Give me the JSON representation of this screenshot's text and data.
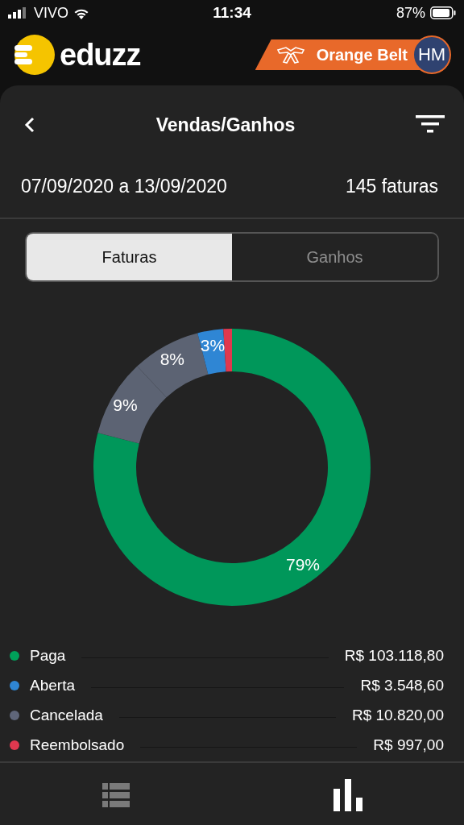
{
  "status_bar": {
    "carrier": "VIVO",
    "time": "11:34",
    "battery": "87%"
  },
  "header": {
    "logo": "eduzz",
    "badge": "Orange Belt",
    "avatar": "HM"
  },
  "title_bar": {
    "title": "Vendas/Ganhos"
  },
  "summary": {
    "period": "07/09/2020 a 13/09/2020",
    "count": "145 faturas"
  },
  "tabs": [
    {
      "label": "Faturas",
      "selected": true
    },
    {
      "label": "Ganhos",
      "selected": false
    }
  ],
  "chart_data": {
    "type": "donut",
    "values": [
      79,
      9,
      8,
      3,
      1
    ],
    "colors": [
      "#00975a",
      "#5c6373",
      "#5c6373",
      "#2f86d4",
      "#e0384f"
    ],
    "value_labels": [
      "79%",
      "9%",
      "8%",
      "3%",
      null
    ]
  },
  "legend": [
    {
      "label": "Paga",
      "value": "R$ 103.118,80",
      "color": "#00a05a"
    },
    {
      "label": "Aberta",
      "value": "R$ 3.548,60",
      "color": "#2f86d4"
    },
    {
      "label": "Cancelada",
      "value": "R$ 10.820,00",
      "color": "#5f667a"
    },
    {
      "label": "Reembolsado",
      "value": "R$ 997,00",
      "color": "#e0384f"
    }
  ],
  "bottom_nav": [
    {
      "kind": "list",
      "selected": false
    },
    {
      "kind": "chart",
      "selected": true
    }
  ]
}
